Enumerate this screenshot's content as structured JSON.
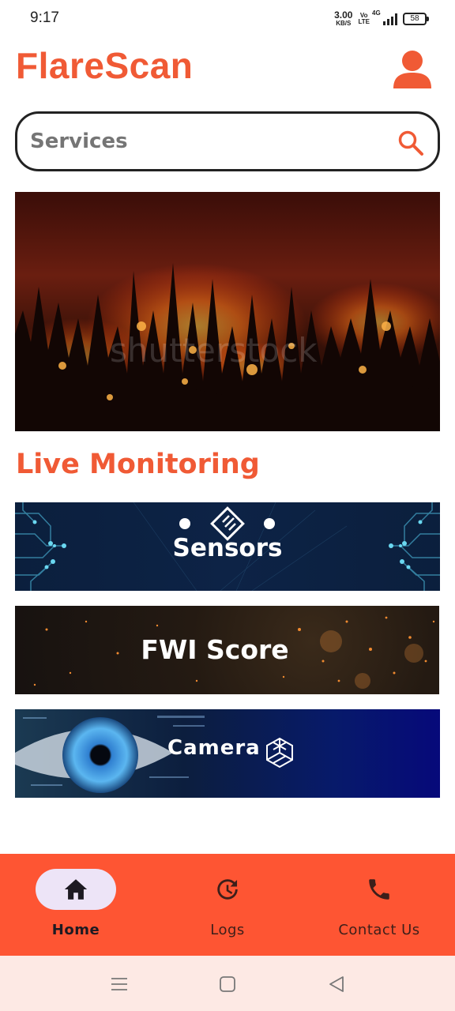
{
  "status_bar": {
    "time": "9:17",
    "net_speed_value": "3.00",
    "net_speed_unit": "KB/S",
    "volte_top": "Vo",
    "volte_bottom": "LTE",
    "network": "4G",
    "battery": "58"
  },
  "header": {
    "app_title": "FlareScan",
    "profile_icon": "person-icon"
  },
  "search": {
    "placeholder": "Services",
    "icon": "search-icon"
  },
  "hero": {
    "image": "forest-fire-photo",
    "watermark": "shutterstock"
  },
  "live_monitoring": {
    "title": "Live Monitoring",
    "cards": [
      {
        "label": "Sensors",
        "icon": "chip-icon"
      },
      {
        "label": "FWI Score"
      },
      {
        "label": "Camera",
        "icon": "cube-icon"
      }
    ]
  },
  "bottom_nav": {
    "items": [
      {
        "label": "Home",
        "icon": "home-icon",
        "active": true
      },
      {
        "label": "Logs",
        "icon": "history-icon",
        "active": false
      },
      {
        "label": "Contact Us",
        "icon": "phone-icon",
        "active": false
      }
    ]
  },
  "colors": {
    "brand": "#f05a35",
    "nav_bg": "#fe5533",
    "nav_active_pill": "#ede4f7",
    "system_nav_bg": "#fde9e4"
  }
}
